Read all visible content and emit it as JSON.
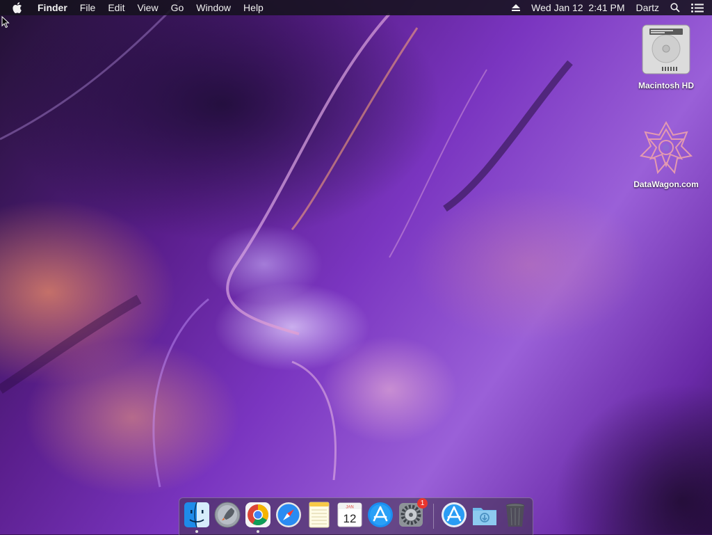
{
  "menubar": {
    "app_name": "Finder",
    "items": [
      "File",
      "Edit",
      "View",
      "Go",
      "Window",
      "Help"
    ],
    "clock": "Wed Jan 12  2:41 PM",
    "user": "Dartz",
    "icons": [
      "apple-icon",
      "eject-icon",
      "spotlight-search-icon",
      "notification-center-icon"
    ]
  },
  "desktop": {
    "icons": [
      {
        "label": "Macintosh HD",
        "icon": "hard-drive-icon"
      },
      {
        "label": "DataWagon.com",
        "icon": "network-volume-icon"
      }
    ]
  },
  "dock": {
    "apps": [
      {
        "name": "Finder",
        "icon": "finder-icon",
        "running": true
      },
      {
        "name": "Launchpad",
        "icon": "launchpad-icon",
        "running": false
      },
      {
        "name": "Google Chrome",
        "icon": "chrome-icon",
        "running": true
      },
      {
        "name": "Safari",
        "icon": "safari-icon",
        "running": false
      },
      {
        "name": "Notes",
        "icon": "notes-icon",
        "running": false
      },
      {
        "name": "Calendar",
        "icon": "calendar-icon",
        "running": false,
        "month": "JAN",
        "day": "12"
      },
      {
        "name": "App Store",
        "icon": "app-store-icon",
        "running": false
      },
      {
        "name": "System Preferences",
        "icon": "system-preferences-icon",
        "running": false,
        "badge": "1"
      },
      {
        "name": "App Store",
        "icon": "app-store-icon",
        "running": false
      },
      {
        "name": "Downloads",
        "icon": "downloads-folder-icon",
        "running": false
      },
      {
        "name": "Trash",
        "icon": "trash-icon",
        "running": false
      }
    ]
  },
  "colors": {
    "menubar_bg": "#16121e",
    "badge": "#e8352e",
    "wallpaper_primary": "#7a35c0"
  }
}
